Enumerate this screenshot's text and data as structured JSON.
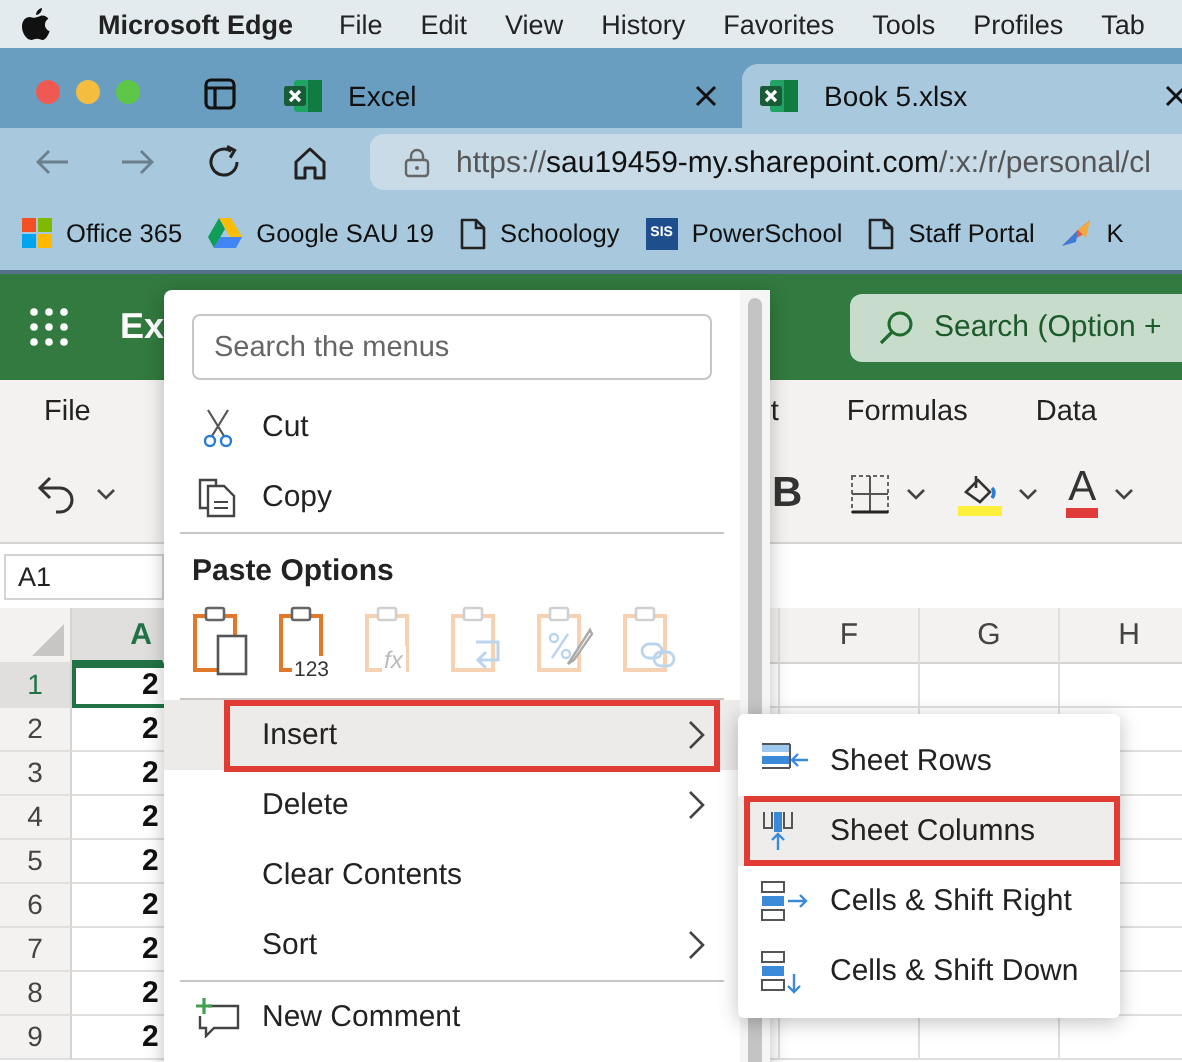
{
  "menubar": {
    "app": "Microsoft Edge",
    "items": [
      "File",
      "Edit",
      "View",
      "History",
      "Favorites",
      "Tools",
      "Profiles",
      "Tab"
    ]
  },
  "tabs": [
    {
      "title": "Excel",
      "selected": false
    },
    {
      "title": "Book 5.xlsx",
      "selected": true
    }
  ],
  "address": {
    "url": "https://**sau19459-my.sharepoint.com**/:x:/r/personal/cl"
  },
  "bookmarks": [
    {
      "label": "Office 365",
      "kind": "office"
    },
    {
      "label": "Google SAU 19",
      "kind": "drive"
    },
    {
      "label": "Schoology",
      "kind": "page"
    },
    {
      "label": "PowerSchool",
      "kind": "badge",
      "badge": "SIS"
    },
    {
      "label": "Staff Portal",
      "kind": "page"
    },
    {
      "label": "K",
      "kind": "bird"
    }
  ],
  "app_bar": {
    "title": "Ex",
    "search_placeholder": "Search (Option +"
  },
  "ribbon_tabs": [
    "File",
    "t",
    "Formulas",
    "Data"
  ],
  "toolbar": {
    "bold_label": "B",
    "font_color_label": "A"
  },
  "name_box": "A1",
  "columns": [
    {
      "label": "A",
      "selected": true
    },
    {
      "label": "F",
      "selected": false
    },
    {
      "label": "G",
      "selected": false
    },
    {
      "label": "H",
      "selected": false
    }
  ],
  "rows": [
    {
      "number": "1",
      "selected": true,
      "cells": [
        "2"
      ]
    },
    {
      "number": "2",
      "selected": false,
      "cells": [
        "2"
      ]
    },
    {
      "number": "3",
      "selected": false,
      "cells": [
        "2"
      ]
    },
    {
      "number": "4",
      "selected": false,
      "cells": [
        "2"
      ]
    },
    {
      "number": "5",
      "selected": false,
      "cells": [
        "2"
      ]
    },
    {
      "number": "6",
      "selected": false,
      "cells": [
        "2"
      ]
    },
    {
      "number": "7",
      "selected": false,
      "cells": [
        "2"
      ]
    },
    {
      "number": "8",
      "selected": false,
      "cells": [
        "2"
      ]
    },
    {
      "number": "9",
      "selected": false,
      "cells": [
        "2"
      ]
    }
  ],
  "context_menu": {
    "search_placeholder": "Search the menus",
    "items": [
      {
        "kind": "command",
        "label": "Cut",
        "selected": false,
        "highlighted": false
      },
      {
        "kind": "command",
        "label": "Copy",
        "selected": false,
        "highlighted": false
      },
      {
        "kind": "separator"
      },
      {
        "kind": "header",
        "label": "Paste Options"
      },
      {
        "kind": "paste_row",
        "options": [
          {
            "disabled": false
          },
          {
            "disabled": false,
            "caption": "123"
          },
          {
            "disabled": true,
            "caption": "fx"
          },
          {
            "disabled": true
          },
          {
            "disabled": true
          },
          {
            "disabled": true
          }
        ]
      },
      {
        "kind": "separator"
      },
      {
        "kind": "submenu",
        "label": "Insert",
        "selected": true,
        "highlighted": true
      },
      {
        "kind": "submenu",
        "label": "Delete",
        "selected": false,
        "highlighted": false
      },
      {
        "kind": "command",
        "label": "Clear Contents",
        "selected": false,
        "highlighted": false
      },
      {
        "kind": "submenu",
        "label": "Sort",
        "selected": false,
        "highlighted": false
      },
      {
        "kind": "separator"
      },
      {
        "kind": "command",
        "label": "New Comment",
        "selected": false,
        "highlighted": false
      }
    ]
  },
  "submenu": {
    "items": [
      {
        "label": "Sheet Rows",
        "selected": false,
        "highlighted": false
      },
      {
        "label": "Sheet Columns",
        "selected": true,
        "highlighted": true
      },
      {
        "label": "Cells & Shift Right",
        "selected": false,
        "highlighted": false
      },
      {
        "label": "Cells & Shift Down",
        "selected": false,
        "highlighted": false
      }
    ]
  }
}
